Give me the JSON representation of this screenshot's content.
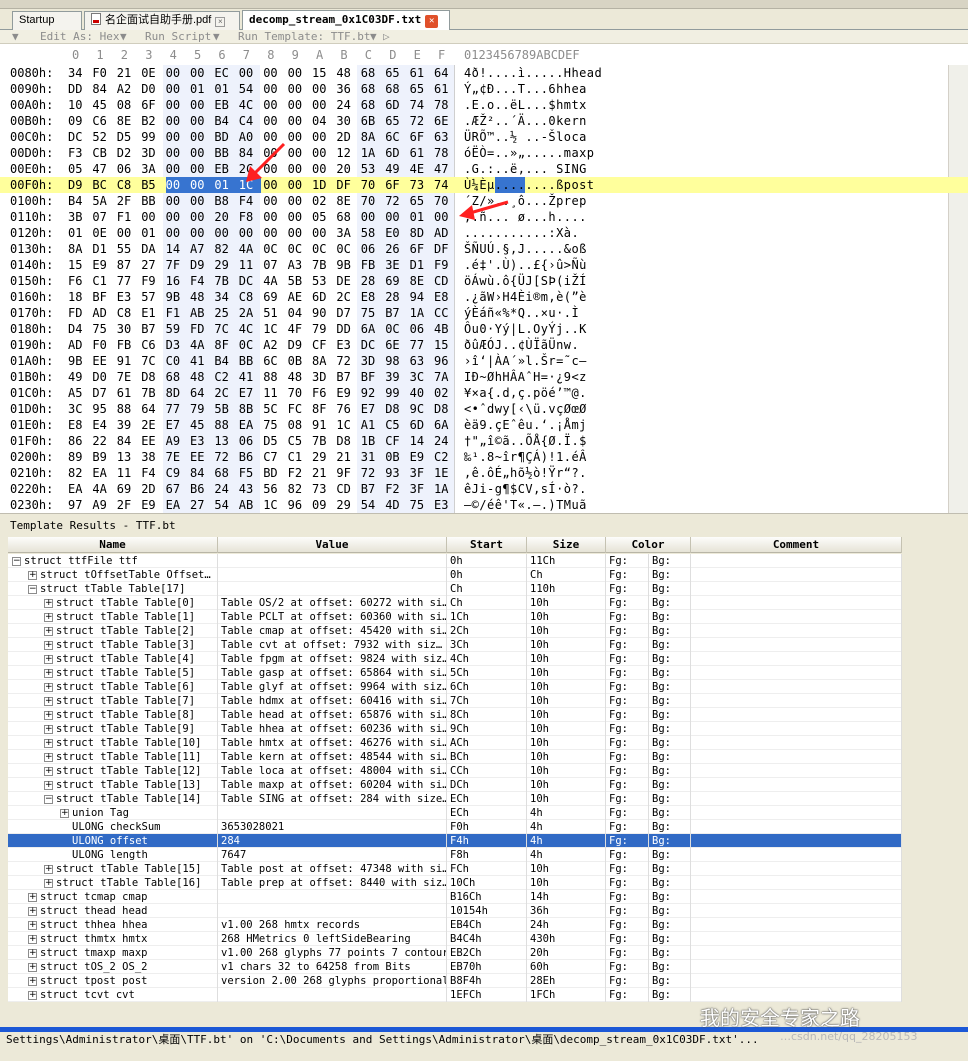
{
  "tabs": [
    {
      "label": "Startup"
    },
    {
      "label": "名企面试自助手册.pdf"
    },
    {
      "label": "decomp_stream_0x1C03DF.txt",
      "active": true
    }
  ],
  "hexbar": {
    "edit_as": "Edit As: Hex",
    "run_script": "Run Script",
    "run_template": "Run Template: TTF.bt"
  },
  "hex_header": {
    "cols": [
      "0",
      "1",
      "2",
      "3",
      "4",
      "5",
      "6",
      "7",
      "8",
      "9",
      "A",
      "B",
      "C",
      "D",
      "E",
      "F"
    ],
    "ascii": "0123456789ABCDEF"
  },
  "hex_rows": [
    {
      "addr": "0080h:",
      "bytes": [
        "34",
        "F0",
        "21",
        "0E",
        "00",
        "00",
        "EC",
        "00",
        "00",
        "00",
        "15",
        "48",
        "68",
        "65",
        "61",
        "64"
      ],
      "ascii": "4ð!....ì.....Hhead"
    },
    {
      "addr": "0090h:",
      "bytes": [
        "DD",
        "84",
        "A2",
        "D0",
        "00",
        "01",
        "01",
        "54",
        "00",
        "00",
        "00",
        "36",
        "68",
        "68",
        "65",
        "61"
      ],
      "ascii": "Ý„¢Ð...T...6hhea"
    },
    {
      "addr": "00A0h:",
      "bytes": [
        "10",
        "45",
        "08",
        "6F",
        "00",
        "00",
        "EB",
        "4C",
        "00",
        "00",
        "00",
        "24",
        "68",
        "6D",
        "74",
        "78"
      ],
      "ascii": ".E.o..ëL...$hmtx"
    },
    {
      "addr": "00B0h:",
      "bytes": [
        "09",
        "C6",
        "8E",
        "B2",
        "00",
        "00",
        "B4",
        "C4",
        "00",
        "00",
        "04",
        "30",
        "6B",
        "65",
        "72",
        "6E"
      ],
      "ascii": ".ÆŽ²..´Ä...0kern"
    },
    {
      "addr": "00C0h:",
      "bytes": [
        "DC",
        "52",
        "D5",
        "99",
        "00",
        "00",
        "BD",
        "A0",
        "00",
        "00",
        "00",
        "2D",
        "8A",
        "6C",
        "6F",
        "63",
        "61"
      ],
      "ascii": "ÜRÕ™..½ ..-Šloca"
    },
    {
      "addr": "00D0h:",
      "bytes": [
        "F3",
        "CB",
        "D2",
        "3D",
        "00",
        "00",
        "BB",
        "84",
        "00",
        "00",
        "00",
        "12",
        "1A",
        "6D",
        "61",
        "78",
        "70"
      ],
      "ascii": "óËÒ=..»„.....maxp"
    },
    {
      "addr": "00E0h:",
      "bytes": [
        "05",
        "47",
        "06",
        "3A",
        "00",
        "00",
        "EB",
        "2C",
        "00",
        "00",
        "00",
        "20",
        "53",
        "49",
        "4E",
        "47"
      ],
      "ascii": ".G.:..ë,... SING"
    },
    {
      "addr": "00F0h:",
      "bytes": [
        "D9",
        "BC",
        "C8",
        "B5",
        "00",
        "00",
        "01",
        "1C",
        "00",
        "00",
        "1D",
        "DF",
        "70",
        "6F",
        "73",
        "74"
      ],
      "ascii": "Ù¼Èµ........ßpost"
    },
    {
      "addr": "0100h:",
      "bytes": [
        "B4",
        "5A",
        "2F",
        "BB",
        "00",
        "00",
        "B8",
        "F4",
        "00",
        "00",
        "02",
        "8E",
        "70",
        "72",
        "65",
        "70"
      ],
      "ascii": "´Z/»..¸ô...Žprep"
    },
    {
      "addr": "0110h:",
      "bytes": [
        "3B",
        "07",
        "F1",
        "00",
        "00",
        "00",
        "20",
        "F8",
        "00",
        "00",
        "05",
        "68",
        "00",
        "00",
        "01",
        "00"
      ],
      "ascii": ";.ñ... ø...h...."
    },
    {
      "addr": "0120h:",
      "bytes": [
        "01",
        "0E",
        "00",
        "01",
        "00",
        "00",
        "00",
        "00",
        "00",
        "00",
        "00",
        "3A",
        "58",
        "E0",
        "8D",
        "AD"
      ],
      "ascii": "...........:Xà.­"
    },
    {
      "addr": "0130h:",
      "bytes": [
        "8A",
        "D1",
        "55",
        "DA",
        "14",
        "A7",
        "82",
        "4A",
        "0C",
        "0C",
        "0C",
        "0C",
        "06",
        "26",
        "6F",
        "DF"
      ],
      "ascii": "ŠÑUÚ.§‚J.....&oß"
    },
    {
      "addr": "0140h:",
      "bytes": [
        "15",
        "E9",
        "87",
        "27",
        "7F",
        "D9",
        "29",
        "11",
        "07",
        "A3",
        "7B",
        "9B",
        "FB",
        "3E",
        "D1",
        "F9"
      ],
      "ascii": ".é‡'.Ù)..£{›û>Ñù"
    },
    {
      "addr": "0150h:",
      "bytes": [
        "F6",
        "C1",
        "77",
        "F9",
        "16",
        "F4",
        "7B",
        "DC",
        "4A",
        "5B",
        "53",
        "DE",
        "28",
        "69",
        "8E",
        "CD"
      ],
      "ascii": "öÁwù.ô{ÜJ[SÞ(iŽÍ"
    },
    {
      "addr": "0160h:",
      "bytes": [
        "18",
        "BF",
        "E3",
        "57",
        "9B",
        "48",
        "34",
        "C8",
        "69",
        "AE",
        "6D",
        "2C",
        "E8",
        "28",
        "94",
        "E8"
      ],
      "ascii": ".¿ãW›H4Èi®m,è(”è"
    },
    {
      "addr": "0170h:",
      "bytes": [
        "FD",
        "AD",
        "C8",
        "E1",
        "F1",
        "AB",
        "25",
        "2A",
        "51",
        "04",
        "90",
        "D7",
        "75",
        "B7",
        "1A",
        "CC"
      ],
      "ascii": "ý­Èáñ«%*Q..×u·.Ì"
    },
    {
      "addr": "0180h:",
      "bytes": [
        "D4",
        "75",
        "30",
        "B7",
        "59",
        "FD",
        "7C",
        "4C",
        "1C",
        "4F",
        "79",
        "DD",
        "6A",
        "0C",
        "06",
        "4B"
      ],
      "ascii": "Ôu0·Yý|L.OyÝj..K"
    },
    {
      "addr": "0190h:",
      "bytes": [
        "AD",
        "F0",
        "FB",
        "C6",
        "D3",
        "4A",
        "8F",
        "0C",
        "A2",
        "D9",
        "CF",
        "E3",
        "DC",
        "6E",
        "77",
        "15"
      ],
      "ascii": "­ðûÆÓJ..¢ÙÏãÜnw."
    },
    {
      "addr": "01A0h:",
      "bytes": [
        "9B",
        "EE",
        "91",
        "7C",
        "C0",
        "41",
        "B4",
        "BB",
        "6C",
        "0B",
        "8A",
        "72",
        "3D",
        "98",
        "63",
        "96"
      ],
      "ascii": "›î‘|ÀA´»l.Šr=˜c–"
    },
    {
      "addr": "01B0h:",
      "bytes": [
        "49",
        "D0",
        "7E",
        "D8",
        "68",
        "48",
        "C2",
        "41",
        "88",
        "48",
        "3D",
        "B7",
        "BF",
        "39",
        "3C",
        "7A"
      ],
      "ascii": "IÐ~ØhHÂAˆH=·¿9<z"
    },
    {
      "addr": "01C0h:",
      "bytes": [
        "A5",
        "D7",
        "61",
        "7B",
        "8D",
        "64",
        "2C",
        "E7",
        "11",
        "70",
        "F6",
        "E9",
        "92",
        "99",
        "40",
        "02"
      ],
      "ascii": "¥×a{.d,ç.pöé’™@."
    },
    {
      "addr": "01D0h:",
      "bytes": [
        "3C",
        "95",
        "88",
        "64",
        "77",
        "79",
        "5B",
        "8B",
        "5C",
        "FC",
        "8F",
        "76",
        "E7",
        "D8",
        "9C",
        "D8"
      ],
      "ascii": "<•ˆdwy[‹\\ü.vçØœØ"
    },
    {
      "addr": "01E0h:",
      "bytes": [
        "E8",
        "E4",
        "39",
        "2E",
        "E7",
        "45",
        "88",
        "EA",
        "75",
        "08",
        "91",
        "1C",
        "A1",
        "C5",
        "6D",
        "6A"
      ],
      "ascii": "èä9.çEˆêu.‘.¡Åmj"
    },
    {
      "addr": "01F0h:",
      "bytes": [
        "86",
        "22",
        "84",
        "EE",
        "A9",
        "E3",
        "13",
        "06",
        "D5",
        "C5",
        "7B",
        "D8",
        "1B",
        "CF",
        "14",
        "24"
      ],
      "ascii": "†\"„î©ã..ÕÅ{Ø.Ï.$"
    },
    {
      "addr": "0200h:",
      "bytes": [
        "89",
        "B9",
        "13",
        "38",
        "7E",
        "EE",
        "72",
        "B6",
        "C7",
        "C1",
        "29",
        "21",
        "31",
        "0B",
        "E9",
        "C2"
      ],
      "ascii": "‰¹.8~îr¶ÇÁ)!1.éÂ"
    },
    {
      "addr": "0210h:",
      "bytes": [
        "82",
        "EA",
        "11",
        "F4",
        "C9",
        "84",
        "68",
        "F5",
        "BD",
        "F2",
        "21",
        "9F",
        "72",
        "93",
        "3F",
        "1E"
      ],
      "ascii": "‚ê.ôÉ„hõ½ò!Ÿr“?."
    },
    {
      "addr": "0220h:",
      "bytes": [
        "EA",
        "4A",
        "69",
        "2D",
        "67",
        "B6",
        "24",
        "43",
        "56",
        "82",
        "73",
        "CD",
        "B7",
        "F2",
        "3F",
        "1A"
      ],
      "ascii": "êJi-g¶$CV‚sÍ·ò?."
    },
    {
      "addr": "0230h:",
      "bytes": [
        "97",
        "A9",
        "2F",
        "E9",
        "EA",
        "27",
        "54",
        "AB",
        "1C",
        "96",
        "09",
        "29",
        "54",
        "4D",
        "75",
        "E3"
      ],
      "ascii": "—©/éê'T«.–.)TMuã"
    }
  ],
  "template": {
    "title": "Template Results - TTF.bt",
    "columns": [
      "Name",
      "Value",
      "Start",
      "Size",
      "Color",
      "Comment"
    ],
    "rows": [
      {
        "indent": 0,
        "exp": "−",
        "name": "struct ttfFile ttf",
        "value": "",
        "start": "0h",
        "size": "11Ch",
        "fg": "Fg:",
        "bg": "Bg:"
      },
      {
        "indent": 1,
        "exp": "+",
        "name": "struct tOffsetTable Offset…",
        "value": "",
        "start": "0h",
        "size": "Ch",
        "fg": "Fg:",
        "bg": "Bg:"
      },
      {
        "indent": 1,
        "exp": "−",
        "name": "struct tTable Table[17]",
        "value": "",
        "start": "Ch",
        "size": "110h",
        "fg": "Fg:",
        "bg": "Bg:"
      },
      {
        "indent": 2,
        "exp": "+",
        "name": "struct tTable Table[0]",
        "value": "Table OS/2 at offset: 60272 with si…",
        "start": "Ch",
        "size": "10h",
        "fg": "Fg:",
        "bg": "Bg:"
      },
      {
        "indent": 2,
        "exp": "+",
        "name": "struct tTable Table[1]",
        "value": "Table PCLT at offset: 60360 with si…",
        "start": "1Ch",
        "size": "10h",
        "fg": "Fg:",
        "bg": "Bg:"
      },
      {
        "indent": 2,
        "exp": "+",
        "name": "struct tTable Table[2]",
        "value": "Table cmap at offset: 45420 with si…",
        "start": "2Ch",
        "size": "10h",
        "fg": "Fg:",
        "bg": "Bg:"
      },
      {
        "indent": 2,
        "exp": "+",
        "name": "struct tTable Table[3]",
        "value": "Table cvt  at offset: 7932 with siz…",
        "start": "3Ch",
        "size": "10h",
        "fg": "Fg:",
        "bg": "Bg:"
      },
      {
        "indent": 2,
        "exp": "+",
        "name": "struct tTable Table[4]",
        "value": "Table fpgm at offset: 9824 with siz…",
        "start": "4Ch",
        "size": "10h",
        "fg": "Fg:",
        "bg": "Bg:"
      },
      {
        "indent": 2,
        "exp": "+",
        "name": "struct tTable Table[5]",
        "value": "Table gasp at offset: 65864 with si…",
        "start": "5Ch",
        "size": "10h",
        "fg": "Fg:",
        "bg": "Bg:"
      },
      {
        "indent": 2,
        "exp": "+",
        "name": "struct tTable Table[6]",
        "value": "Table glyf at offset: 9964 with siz…",
        "start": "6Ch",
        "size": "10h",
        "fg": "Fg:",
        "bg": "Bg:"
      },
      {
        "indent": 2,
        "exp": "+",
        "name": "struct tTable Table[7]",
        "value": "Table hdmx at offset: 60416 with si…",
        "start": "7Ch",
        "size": "10h",
        "fg": "Fg:",
        "bg": "Bg:"
      },
      {
        "indent": 2,
        "exp": "+",
        "name": "struct tTable Table[8]",
        "value": "Table head at offset: 65876 with si…",
        "start": "8Ch",
        "size": "10h",
        "fg": "Fg:",
        "bg": "Bg:"
      },
      {
        "indent": 2,
        "exp": "+",
        "name": "struct tTable Table[9]",
        "value": "Table hhea at offset: 60236 with si…",
        "start": "9Ch",
        "size": "10h",
        "fg": "Fg:",
        "bg": "Bg:"
      },
      {
        "indent": 2,
        "exp": "+",
        "name": "struct tTable Table[10]",
        "value": "Table hmtx at offset: 46276 with si…",
        "start": "ACh",
        "size": "10h",
        "fg": "Fg:",
        "bg": "Bg:"
      },
      {
        "indent": 2,
        "exp": "+",
        "name": "struct tTable Table[11]",
        "value": "Table kern at offset: 48544 with si…",
        "start": "BCh",
        "size": "10h",
        "fg": "Fg:",
        "bg": "Bg:"
      },
      {
        "indent": 2,
        "exp": "+",
        "name": "struct tTable Table[12]",
        "value": "Table loca at offset: 48004 with si…",
        "start": "CCh",
        "size": "10h",
        "fg": "Fg:",
        "bg": "Bg:"
      },
      {
        "indent": 2,
        "exp": "+",
        "name": "struct tTable Table[13]",
        "value": "Table maxp at offset: 60204 with si…",
        "start": "DCh",
        "size": "10h",
        "fg": "Fg:",
        "bg": "Bg:"
      },
      {
        "indent": 2,
        "exp": "−",
        "name": "struct tTable Table[14]",
        "value": "Table SING at offset: 284 with size…",
        "start": "ECh",
        "size": "10h",
        "fg": "Fg:",
        "bg": "Bg:"
      },
      {
        "indent": 3,
        "exp": "+",
        "name": "union Tag",
        "value": "",
        "start": "ECh",
        "size": "4h",
        "fg": "Fg:",
        "bg": "Bg:"
      },
      {
        "indent": 3,
        "exp": "",
        "name": "ULONG checkSum",
        "value": "3653028021",
        "start": "F0h",
        "size": "4h",
        "fg": "Fg:",
        "bg": "Bg:"
      },
      {
        "indent": 3,
        "exp": "",
        "name": "ULONG offset",
        "value": "284",
        "start": "F4h",
        "size": "4h",
        "fg": "Fg:",
        "bg": "Bg:",
        "selected": true
      },
      {
        "indent": 3,
        "exp": "",
        "name": "ULONG length",
        "value": "7647",
        "start": "F8h",
        "size": "4h",
        "fg": "Fg:",
        "bg": "Bg:"
      },
      {
        "indent": 2,
        "exp": "+",
        "name": "struct tTable Table[15]",
        "value": "Table post at offset: 47348 with si…",
        "start": "FCh",
        "size": "10h",
        "fg": "Fg:",
        "bg": "Bg:"
      },
      {
        "indent": 2,
        "exp": "+",
        "name": "struct tTable Table[16]",
        "value": "Table prep at offset: 8440 with siz…",
        "start": "10Ch",
        "size": "10h",
        "fg": "Fg:",
        "bg": "Bg:"
      },
      {
        "indent": 1,
        "exp": "+",
        "name": "struct tcmap cmap",
        "value": "",
        "start": "B16Ch",
        "size": "14h",
        "fg": "Fg:",
        "bg": "Bg:"
      },
      {
        "indent": 1,
        "exp": "+",
        "name": "struct thead head",
        "value": "",
        "start": "10154h",
        "size": "36h",
        "fg": "Fg:",
        "bg": "Bg:"
      },
      {
        "indent": 1,
        "exp": "+",
        "name": "struct thhea hhea",
        "value": "v1.00 268 hmtx records",
        "start": "EB4Ch",
        "size": "24h",
        "fg": "Fg:",
        "bg": "Bg:"
      },
      {
        "indent": 1,
        "exp": "+",
        "name": "struct thmtx hmtx",
        "value": "268 HMetrics 0 leftSideBearing",
        "start": "B4C4h",
        "size": "430h",
        "fg": "Fg:",
        "bg": "Bg:"
      },
      {
        "indent": 1,
        "exp": "+",
        "name": "struct tmaxp maxp",
        "value": "v1.00 268 glyphs 77 points 7 contours",
        "start": "EB2Ch",
        "size": "20h",
        "fg": "Fg:",
        "bg": "Bg:"
      },
      {
        "indent": 1,
        "exp": "+",
        "name": "struct tOS_2 OS_2",
        "value": "v1 chars 32 to 64258 from Bits",
        "start": "EB70h",
        "size": "60h",
        "fg": "Fg:",
        "bg": "Bg:"
      },
      {
        "indent": 1,
        "exp": "+",
        "name": "struct tpost post",
        "value": "version 2.00 268 glyphs proportional",
        "start": "B8F4h",
        "size": "28Eh",
        "fg": "Fg:",
        "bg": "Bg:"
      },
      {
        "indent": 1,
        "exp": "+",
        "name": "struct tcvt cvt",
        "value": "",
        "start": "1EFCh",
        "size": "1FCh",
        "fg": "Fg:",
        "bg": "Bg:"
      }
    ]
  },
  "status": "Settings\\Administrator\\桌面\\TTF.bt' on 'C:\\Documents and Settings\\Administrator\\桌面\\decomp_stream_0x1C03DF.txt'...",
  "watermark": "我的安全专家之路",
  "watermark_url": "…csdn.net/qq_28205153",
  "colors": {
    "selection": "#316ac5",
    "hex_selection": "#3774d0",
    "highlight_row": "#ffff9c",
    "arrow": "#ff2020",
    "status_blue": "#1c58d6"
  },
  "selected_hex": {
    "row": 7,
    "cols": [
      4,
      5,
      6,
      7
    ]
  }
}
